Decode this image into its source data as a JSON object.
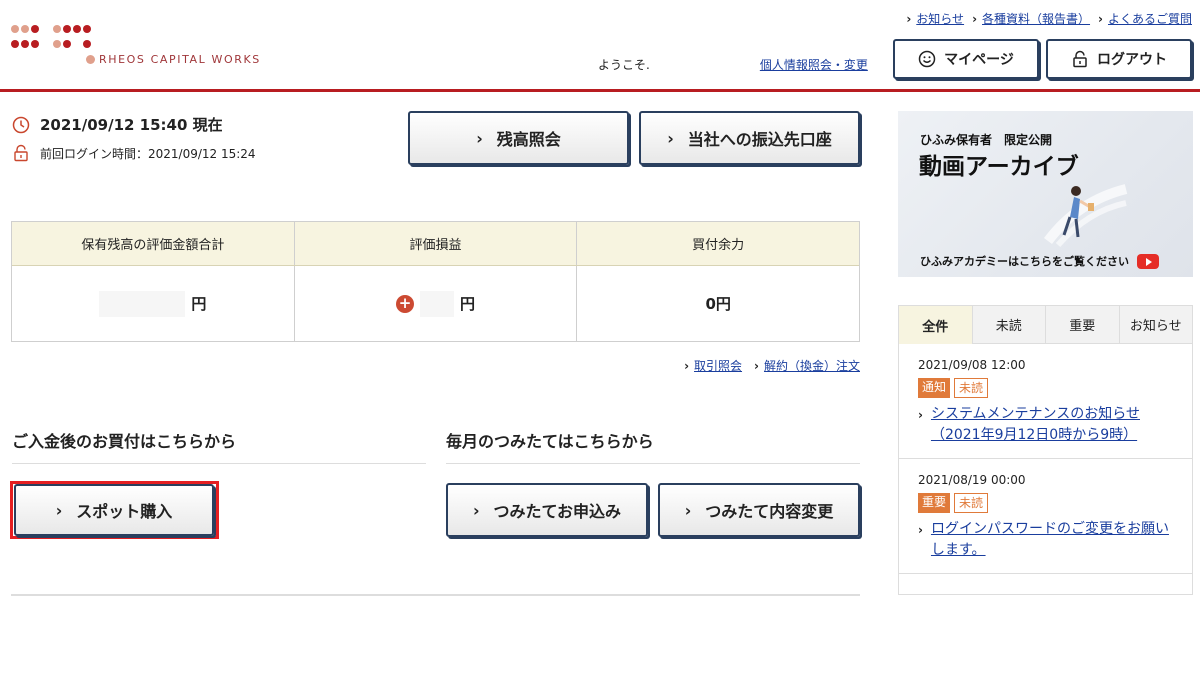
{
  "header": {
    "brand_text": "RHEOS CAPITAL WORKS",
    "top_links": [
      "お知らせ",
      "各種資料（報告書）",
      "よくあるご質問"
    ],
    "welcome": "ようこそ.",
    "profile_link": "個人情報照会・変更",
    "mypage_label": "マイページ",
    "logout_label": "ログアウト",
    "accent_color": "#b81d21"
  },
  "status": {
    "datetime": "2021/09/12 15:40 現在",
    "last_login": "前回ログイン時間：2021/09/12 15:24"
  },
  "actions": {
    "balance_label": "残高照会",
    "transfer_label": "当社への振込先口座"
  },
  "summary": {
    "headers": [
      "保有残高の評価金額合計",
      "評価損益",
      "買付余力"
    ],
    "values": [
      "円",
      "円",
      "0円"
    ]
  },
  "sublinks": [
    "取引照会",
    "解約（換金）注文"
  ],
  "sections": {
    "spot": {
      "title": "ご入金後のお買付はこちらから",
      "button": "スポット購入"
    },
    "monthly": {
      "title": "毎月のつみたてはこちらから",
      "apply_button": "つみたてお申込み",
      "change_button": "つみたて内容変更"
    }
  },
  "banner": {
    "subtitle": "ひふみ保有者　限定公開",
    "title": "動画アーカイブ",
    "footer": "ひふみアカデミーはこちらをご覧ください"
  },
  "news": {
    "tabs": [
      "全件",
      "未読",
      "重要",
      "お知らせ"
    ],
    "active_tab": 0,
    "items": [
      {
        "date": "2021/09/08 12:00",
        "badge1": "通知",
        "badge2": "未読",
        "title": "システムメンテナンスのお知らせ（2021年9月12日0時から9時）"
      },
      {
        "date": "2021/08/19 00:00",
        "badge1": "重要",
        "badge2": "未読",
        "title": "ログインパスワードのご変更をお願いします。"
      }
    ]
  },
  "icons": [
    "clock-icon",
    "unlock-icon",
    "smile-icon",
    "logout-lock-icon",
    "plus-icon",
    "youtube-icon",
    "chevron-right-icon"
  ]
}
